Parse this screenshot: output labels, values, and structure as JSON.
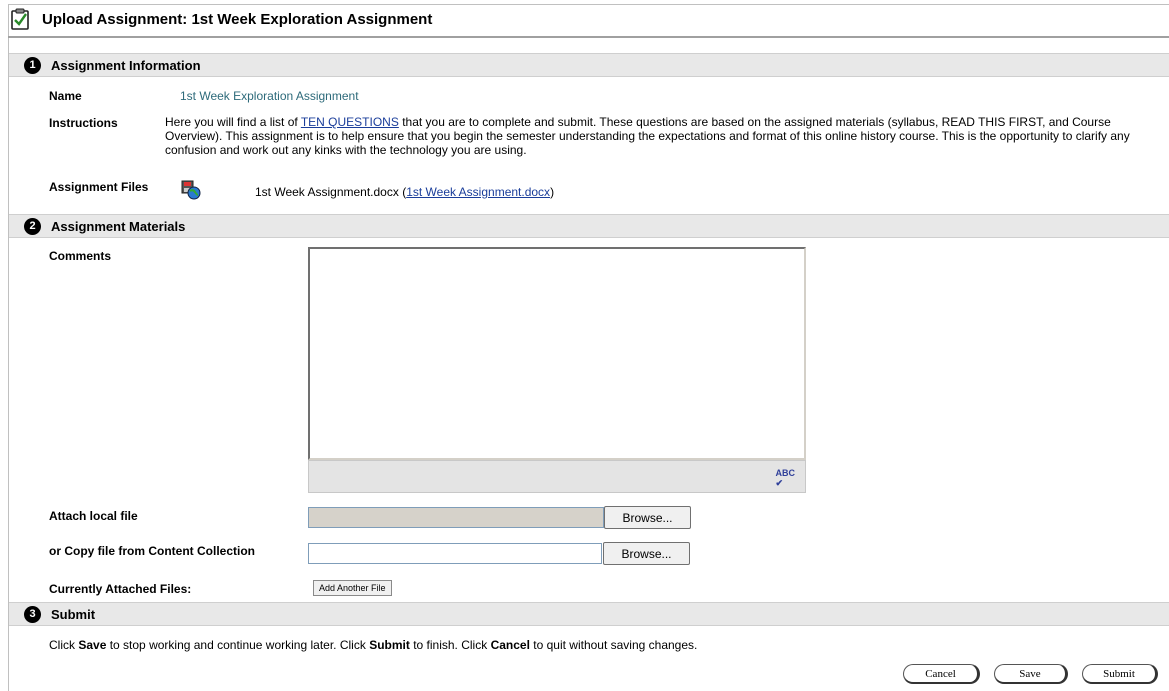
{
  "header": {
    "title": "Upload Assignment: 1st Week Exploration Assignment"
  },
  "sections": {
    "one": {
      "num": "1",
      "title": "Assignment Information"
    },
    "two": {
      "num": "2",
      "title": "Assignment Materials"
    },
    "three": {
      "num": "3",
      "title": "Submit"
    }
  },
  "info": {
    "name_label": "Name",
    "name_value": "1st Week Exploration Assignment",
    "instructions_label": "Instructions",
    "instructions_pre": "Here you will find a list of ",
    "instructions_link": "TEN QUESTIONS",
    "instructions_post": " that you are to complete and submit. These questions are based on the assigned materials (syllabus, READ THIS FIRST, and Course Overview). This assignment is to help ensure that you begin the semester understanding the expectations and format of this online history course. This is the opportunity to clarify any confusion and work out any kinks with the technology you are using.",
    "files_label": "Assignment Files",
    "file_name": "1st Week Assignment.docx",
    "file_paren_open": "(",
    "file_link": "1st Week Assignment.docx",
    "file_paren_close": ")"
  },
  "materials": {
    "comments_label": "Comments",
    "comments_value": "",
    "attach_label": "Attach local file",
    "attach_value": "",
    "copy_label": "or Copy file from Content Collection",
    "copy_value": "",
    "browse_label": "Browse...",
    "attached_label": "Currently Attached Files:",
    "add_file_label": "Add Another File",
    "spell_icon_text": "ABC"
  },
  "submit": {
    "t1": "Click ",
    "save_word": "Save",
    "t2": " to stop working and continue working later. Click ",
    "submit_word": "Submit",
    "t3": " to finish. Click ",
    "cancel_word": "Cancel",
    "t4": " to quit without saving changes.",
    "cancel_btn": "Cancel",
    "save_btn": "Save",
    "submit_btn": "Submit"
  }
}
